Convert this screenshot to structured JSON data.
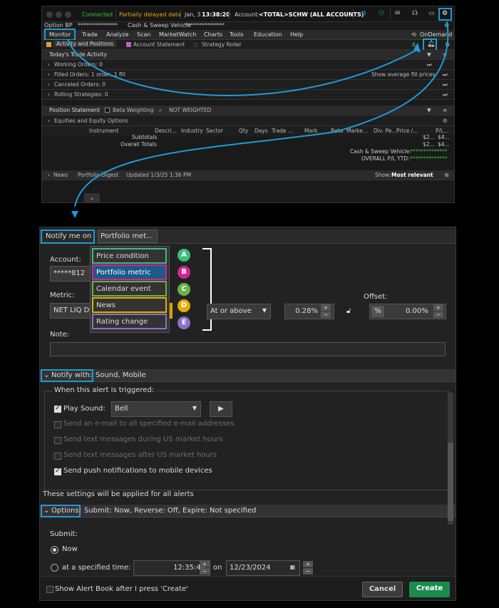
{
  "top": {
    "status_connected": "Connected",
    "status_delayed": "Partially delayed data",
    "date": "Jan, 3",
    "time": "13:38:20",
    "account_label": "Account:",
    "account_value": "<TOTAL>SCHW (ALL ACCOUNTS)",
    "option_bp": "Option BP",
    "option_bp_value": "**************",
    "cash_vehicle": "Cash & Sweep Vehicle",
    "cash_vehicle_value": "**************"
  },
  "menu": [
    "Monitor",
    "Trade",
    "Analyze",
    "Scan",
    "MarketWatch",
    "Charts",
    "Tools",
    "Education",
    "Help"
  ],
  "ondemand": "OnDemand",
  "subtabs": {
    "activity": "Activity and Positions",
    "statement": "Account Statement",
    "roller": "Strategy Roller"
  },
  "sections": {
    "todays_trade": "Today's Trade Activity",
    "working": "Working Orders: 0",
    "filled": "Filled Orders: 1 order, 1 fill",
    "avg_fill": "Show average fill prices",
    "canceled": "Canceled Orders: 0",
    "rolling": "Rolling Strategies: 0",
    "position_statement": "Position Statement",
    "beta_weighting": "Beta Weighting",
    "not_weighted": "NOT WEIGHTED",
    "equities": "Equities and Equity Options"
  },
  "columns": [
    "Instrument",
    "Descri...",
    "Industry",
    "Sector",
    "Qty",
    "Days",
    "Trade ...",
    "Mark",
    "Beta",
    "Marke...",
    "Div. Pe...",
    "Price /...",
    "P/L..."
  ],
  "totals": {
    "subtotals": "Subtotals",
    "overall": "Overall Totals",
    "sub_val": "$2...",
    "sub_val2": "$4...",
    "ov_val": "$2...",
    "ov_val2": "$4...",
    "cash_sweep": "Cash & Sweep Vehicle:",
    "cash_sweep_val": "**************",
    "pl_ytd": "OVERALL P/L YTD:",
    "pl_ytd_val": "**************"
  },
  "newsbar": {
    "news": "News",
    "digest": "Portfolio Digest",
    "updated": "Updated 1/3/25 1:36 PM",
    "show_label": "Show:",
    "show_value": "Most relevant"
  },
  "alert": {
    "notify_me_on": "Notify me on",
    "selected_type": "Portfolio met...",
    "account_label": "Account:",
    "account_value": "*****812",
    "metric_label": "Metric:",
    "metric_value": "NET LIQ D",
    "dropdown": [
      {
        "label": "Price condition",
        "badge": "A",
        "color": "#3dbd7d"
      },
      {
        "label": "Portfolio metric",
        "badge": "B",
        "color": "#d1268f"
      },
      {
        "label": "Calendar event",
        "badge": "C",
        "color": "#6ab04c"
      },
      {
        "label": "News",
        "badge": "D",
        "color": "#e0b000"
      },
      {
        "label": "Rating change",
        "badge": "E",
        "color": "#8a72c8"
      }
    ],
    "condition": "At or above",
    "threshold": "0.28%",
    "offset_label": "Offset:",
    "offset_unit": "%",
    "offset_value": "0.00%",
    "note_label": "Note:",
    "notify_with_label": "Notify with:",
    "notify_with_value": "Sound, Mobile",
    "when_triggered": "When this alert is triggered:",
    "play_sound": "Play Sound:",
    "sound_value": "Bell",
    "opt_email": "Send an e-mail to all specified e-mail addresses",
    "opt_text_during": "Send text messages during US market hours",
    "opt_text_after": "Send text messages after US market hours",
    "opt_push": "Send push notifications to mobile devices",
    "applied_all": "These settings will be applied for all alerts",
    "options_label": "Options:",
    "options_value": "Submit: Now, Reverse: Off, Expire: Not specified",
    "submit_label": "Submit:",
    "now": "Now",
    "at_time": "at a specified time:",
    "time_value": "12:35:40",
    "on": "on",
    "date_value": "12/23/2024",
    "show_alert_book": "Show Alert Book after I press 'Create'",
    "cancel": "Cancel",
    "create": "Create"
  },
  "colors": {
    "highlight": "#1d9bd8",
    "connected": "#3fbf3f",
    "delayed": "#e6a817",
    "create": "#1a8c4e"
  }
}
